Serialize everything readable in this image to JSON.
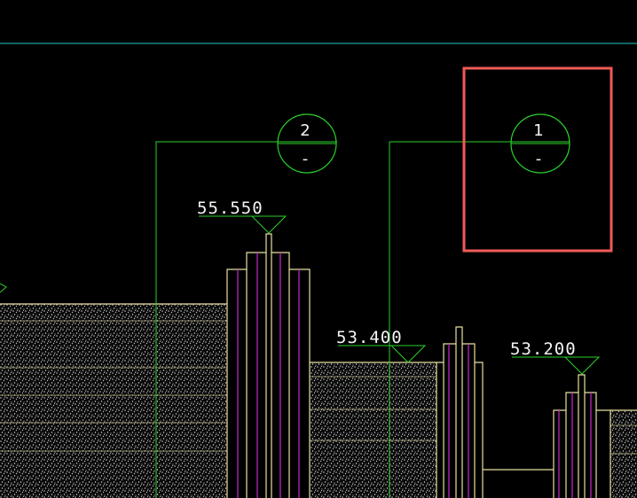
{
  "drawing": {
    "elevations": {
      "e1": "55.550",
      "e2": "53.400",
      "e3": "53.200"
    },
    "section_marks": [
      {
        "number": "2",
        "sheet": "-"
      },
      {
        "number": "1",
        "sheet": "-"
      }
    ],
    "colors": {
      "background": "#000000",
      "guide_line": "#22c7c7",
      "leader": "#2bd12b",
      "outline": "#e8e0a0",
      "inner": "#c42bd0",
      "selection": "#f15b57",
      "text": "#f4f4f4",
      "hatch": "#cfcfcf"
    }
  }
}
